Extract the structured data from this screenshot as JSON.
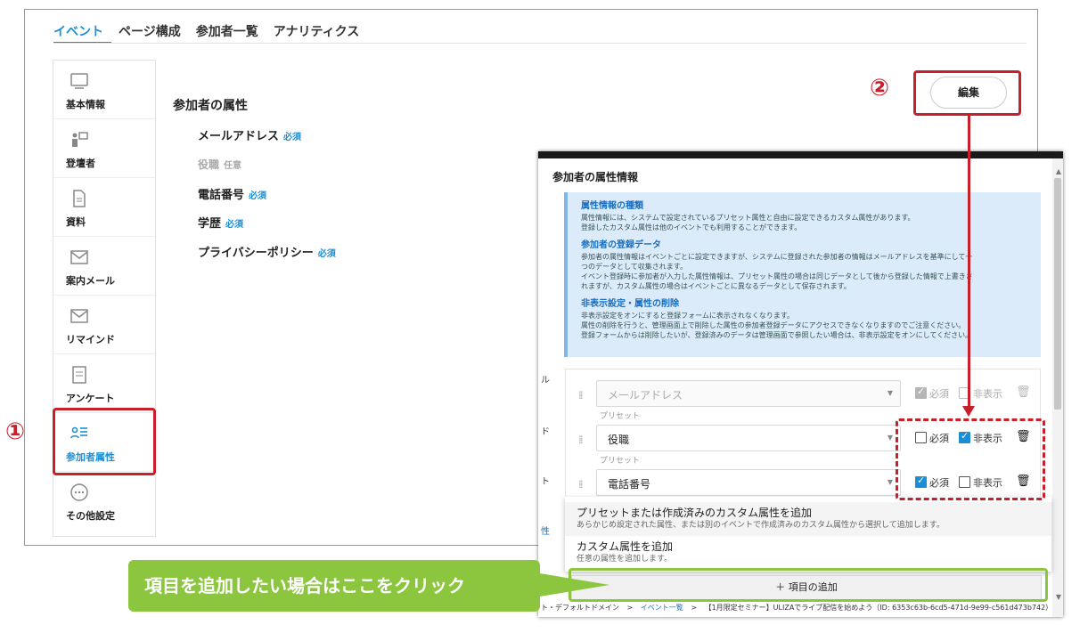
{
  "tabs": [
    "イベント",
    "ページ構成",
    "参加者一覧",
    "アナリティクス"
  ],
  "sidebar": {
    "items": [
      {
        "label": "基本情報",
        "icon": "monitor-icon"
      },
      {
        "label": "登壇者",
        "icon": "presenter-icon"
      },
      {
        "label": "資料",
        "icon": "document-icon"
      },
      {
        "label": "案内メール",
        "icon": "mail-icon"
      },
      {
        "label": "リマインド",
        "icon": "reminder-mail-icon"
      },
      {
        "label": "アンケート",
        "icon": "survey-icon"
      },
      {
        "label": "参加者属性",
        "icon": "attendee-attributes-icon"
      },
      {
        "label": "その他設定",
        "icon": "more-icon"
      }
    ]
  },
  "main": {
    "section_title": "参加者の属性",
    "attributes": [
      {
        "name": "メールアドレス",
        "tag": "必須"
      },
      {
        "name": "役職",
        "tag": "任意"
      },
      {
        "name": "電話番号",
        "tag": "必須"
      },
      {
        "name": "学歴",
        "tag": "必須"
      },
      {
        "name": "プライバシーポリシー",
        "tag": "必須"
      }
    ],
    "edit_button": "編集"
  },
  "annotations": {
    "num1": "①",
    "num2": "②",
    "callout": "項目を追加したい場合はここをクリック"
  },
  "dialog": {
    "title": "参加者の属性情報",
    "info": {
      "h1": "属性情報の種類",
      "p1": "属性情報には、システムで設定されているプリセット属性と自由に設定できるカスタム属性があります。\n登録したカスタム属性は他のイベントでも利用することができます。",
      "h2": "参加者の登録データ",
      "p2": "参加者の属性情報はイベントごとに設定できますが、システムに登録された参加者の情報はメールアドレスを基準にして一\nつのデータとして収集されます。\nイベント登録時に参加者が入力した属性情報は、プリセット属性の場合は同じデータとして後から登録した情報で上書きさ\nれますが、カスタム属性の場合はイベントごとに異なるデータとして保存されます。",
      "h3": "非表示設定・属性の削除",
      "p3": "非表示設定をオンにすると登録フォームに表示されなくなります。\n属性の削除を行うと、管理画面上で削除した属性の参加者登録データにアクセスできなくなりますのでご注意ください。\n登録フォームからは削除したいが、登録済みのデータは管理画面で参照したい場合は、非表示設定をオンにしてください。"
    },
    "rows": [
      {
        "value": "メールアドレス",
        "sub": "プリセット",
        "required": true,
        "hidden": false,
        "disabled": true
      },
      {
        "value": "役職",
        "sub": "プリセット",
        "required": false,
        "hidden": true,
        "disabled": false
      },
      {
        "value": "電話番号",
        "sub": "",
        "required": true,
        "hidden": false,
        "disabled": false
      }
    ],
    "required_label": "必須",
    "hidden_label": "非表示",
    "dropdown": [
      {
        "title": "プリセットまたは作成済みのカスタム属性を追加",
        "sub": "あらかじめ設定された属性、または別のイベントで作成済みのカスタム属性から選択して追加します。"
      },
      {
        "title": "カスタム属性を追加",
        "sub": "任意の属性を追加します。"
      }
    ],
    "add_button": "＋ 項目の追加",
    "breadcrumb": {
      "prefix": "ト・デフォルトドメイン",
      "sep": ">",
      "link": "イベント一覧",
      "tail": "【1月限定セミナー】ULIZAでライブ配信を始めよう（ID: 6353c63b-6cd5-471d-9e99-c561d473b742）"
    },
    "clipped": [
      "ル",
      "ド",
      "ト",
      "性",
      "定"
    ]
  },
  "colors": {
    "accent": "#1a8fd6",
    "annotation_red": "#c8202b",
    "callout_green": "#8cc63f",
    "info_bg": "#dcebf9"
  }
}
